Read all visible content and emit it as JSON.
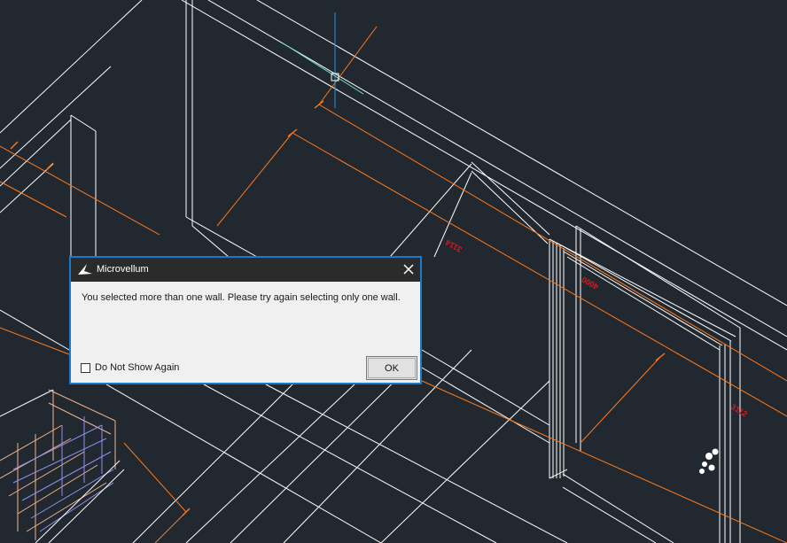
{
  "viewport": {
    "dimensions": [
      "3114",
      "4000",
      "3112"
    ]
  },
  "dialog": {
    "title": "Microvellum",
    "message": "You selected more than one wall. Please try again selecting only one wall.",
    "checkbox_label": "Do Not Show Again",
    "checkbox_checked": false,
    "ok_label": "OK",
    "close_icon": "close-icon",
    "logo_icon": "microvellum-logo-icon"
  },
  "colors": {
    "background": "#212830",
    "wireframe": "#ffffff",
    "dimension_line": "#ff7a1a",
    "dimension_text": "#e01818",
    "dialog_border": "#1979ca",
    "titlebar": "#2b2b2b"
  }
}
